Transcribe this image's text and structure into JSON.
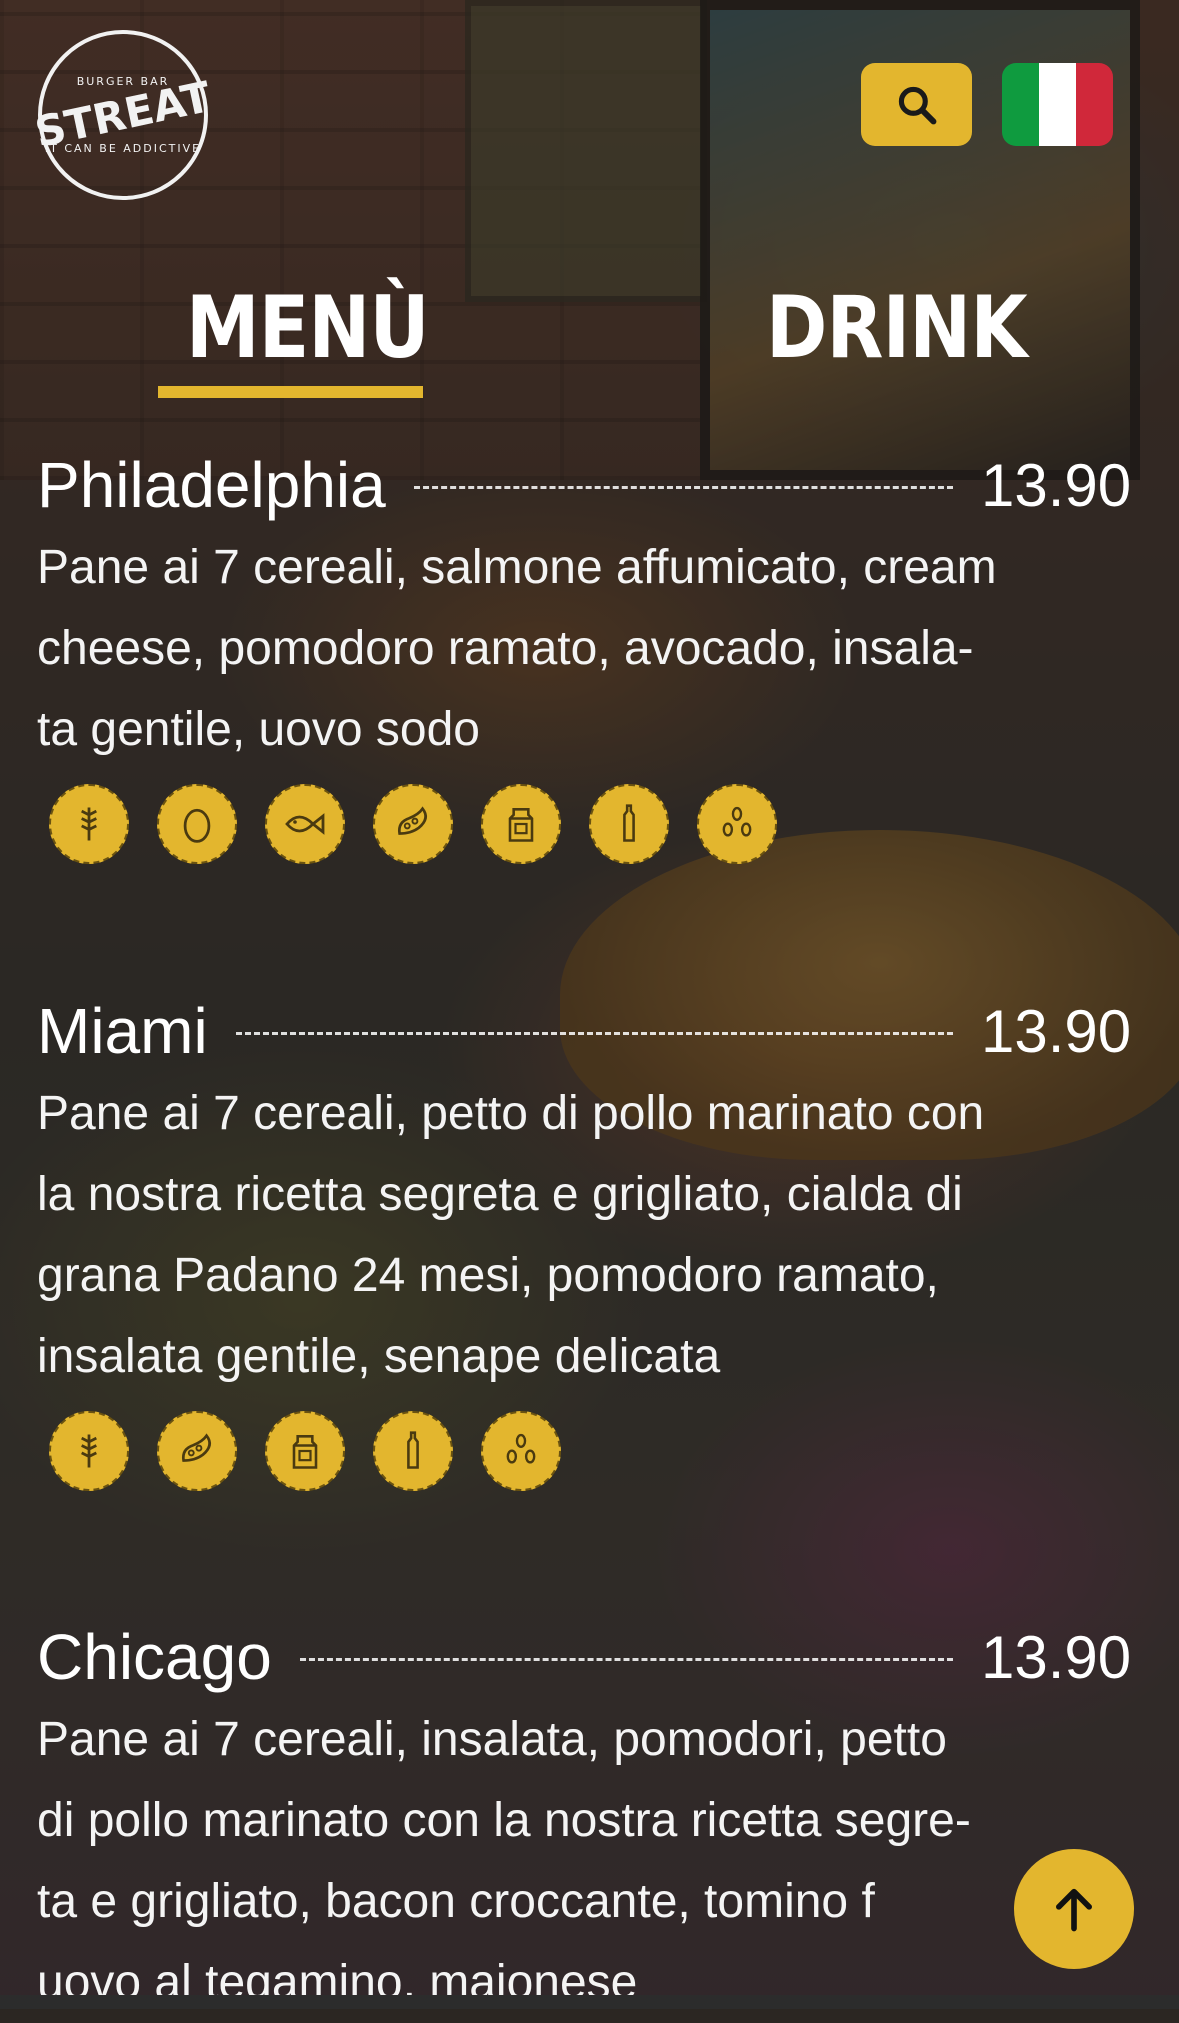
{
  "logo": {
    "top_text": "BURGER BAR",
    "name": "STREAT",
    "bottom_text": "IT CAN BE ADDICTIVE"
  },
  "header": {
    "search_icon": "search-icon",
    "language": "Italiano",
    "flag_colors": [
      "#0f9b3f",
      "#ffffff",
      "#d0283a"
    ]
  },
  "tabs": [
    {
      "label": "MENÙ",
      "active": true
    },
    {
      "label": "DRINK",
      "active": false
    }
  ],
  "colors": {
    "accent": "#e3b62e"
  },
  "items": [
    {
      "name": "Philadelphia",
      "price": "13.90",
      "description": "Pane ai 7 cereali, salmone affumicato, cream\ncheese, pomodoro ramato, avocado, insala-\nta gentile, uovo sodo",
      "allergens": [
        "gluten-icon",
        "egg-icon",
        "fish-icon",
        "soy-icon",
        "milk-icon",
        "mustard-icon",
        "sesame-icon"
      ]
    },
    {
      "name": "Miami",
      "price": "13.90",
      "description": "Pane ai 7 cereali, petto di pollo marinato con\nla nostra ricetta segreta e grigliato, cialda di\ngrana Padano 24 mesi, pomodoro ramato,\ninsalata gentile, senape delicata",
      "allergens": [
        "gluten-icon",
        "soy-icon",
        "milk-icon",
        "mustard-icon",
        "sesame-icon"
      ]
    },
    {
      "name": "Chicago",
      "price": "13.90",
      "description": "Pane ai 7 cereali, insalata, pomodori, petto\ndi pollo marinato con la nostra ricetta segre-\nta e grigliato, bacon croccante, tomino f\nuovo al tegamino, maionese"
    }
  ],
  "scroll_top": {
    "icon": "arrow-up-icon"
  }
}
